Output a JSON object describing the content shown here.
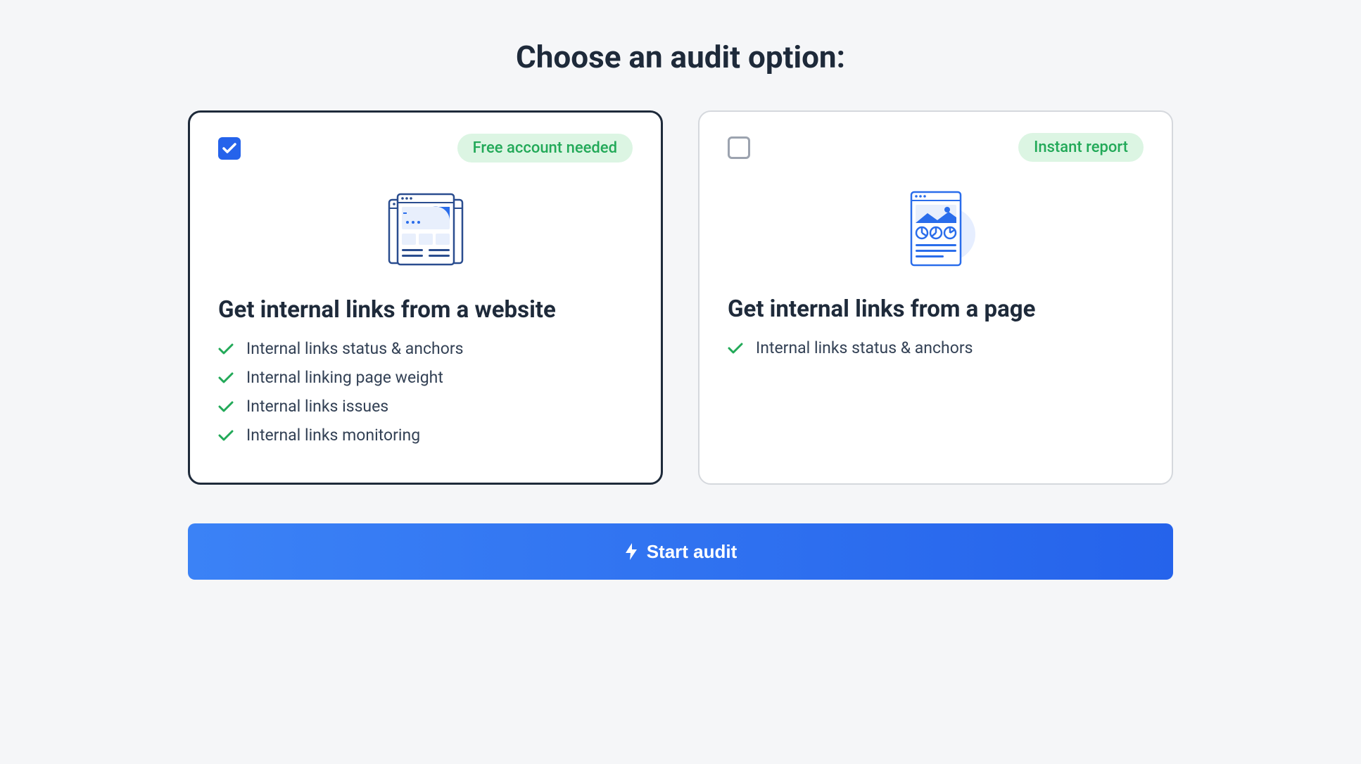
{
  "title": "Choose an audit option:",
  "options": [
    {
      "selected": true,
      "badge": "Free account needed",
      "heading": "Get internal links from a website",
      "features": [
        "Internal links status & anchors",
        "Internal linking page weight",
        "Internal links issues",
        "Internal links monitoring"
      ]
    },
    {
      "selected": false,
      "badge": "Instant report",
      "heading": "Get internal links from a page",
      "features": [
        "Internal links status & anchors"
      ]
    }
  ],
  "cta": "Start audit"
}
